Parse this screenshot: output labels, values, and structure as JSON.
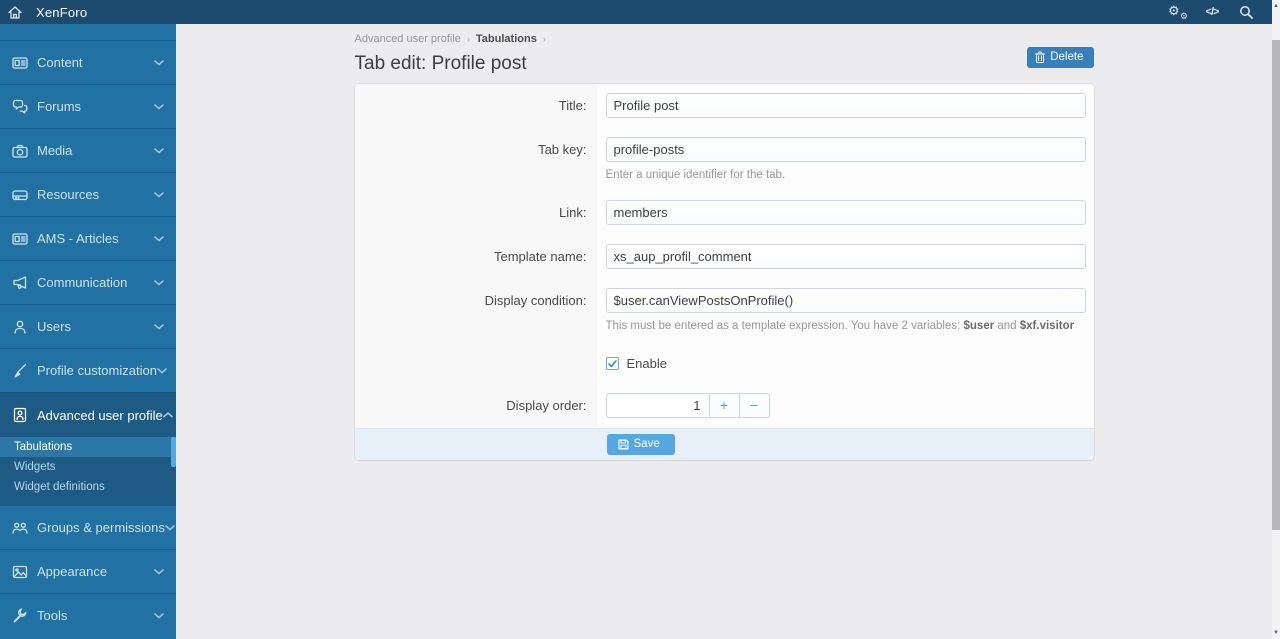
{
  "topbar": {
    "brand": "XenForo",
    "icons": [
      "home-icon",
      "gears-icon",
      "code-icon",
      "search-icon"
    ],
    "code_glyph": "</>"
  },
  "sidebar": {
    "items": [
      {
        "label": "Content",
        "icon": "content-icon"
      },
      {
        "label": "Forums",
        "icon": "forums-icon"
      },
      {
        "label": "Media",
        "icon": "media-icon"
      },
      {
        "label": "Resources",
        "icon": "resources-icon"
      },
      {
        "label": "AMS - Articles",
        "icon": "articles-icon"
      },
      {
        "label": "Communication",
        "icon": "communication-icon"
      },
      {
        "label": "Users",
        "icon": "users-icon"
      },
      {
        "label": "Profile customization",
        "icon": "profile-customization-icon"
      }
    ],
    "group": {
      "label": "Advanced user profile",
      "icon": "advanced-user-profile-icon",
      "expanded": true,
      "subitems": [
        {
          "label": "Tabulations",
          "selected": true
        },
        {
          "label": "Widgets",
          "selected": false
        },
        {
          "label": "Widget definitions",
          "selected": false
        }
      ]
    },
    "items_after": [
      {
        "label": "Groups & permissions",
        "icon": "groups-icon"
      },
      {
        "label": "Appearance",
        "icon": "appearance-icon"
      },
      {
        "label": "Tools",
        "icon": "tools-icon"
      }
    ]
  },
  "breadcrumb": {
    "separator": "›",
    "items": [
      "Advanced user profile",
      "Tabulations"
    ]
  },
  "page": {
    "title": "Tab edit: Profile post"
  },
  "actions": {
    "delete_label": "Delete",
    "save_label": "Save"
  },
  "form": {
    "title": {
      "label": "Title:",
      "value": "Profile post"
    },
    "tab_key": {
      "label": "Tab key:",
      "value": "profile-posts",
      "hint": "Enter a unique identifier for the tab."
    },
    "link": {
      "label": "Link:",
      "value": "members"
    },
    "template_name": {
      "label": "Template name:",
      "value": "xs_aup_profil_comment"
    },
    "display_condition": {
      "label": "Display condition:",
      "value": "$user.canViewPostsOnProfile()",
      "hint_prefix": "This must be entered as a template expression. You have 2 variables: ",
      "var1": "$user",
      "hint_and": " and ",
      "var2": "$xf.visitor"
    },
    "enable": {
      "label": "Enable",
      "checked": true
    },
    "display_order": {
      "label": "Display order:",
      "value": "1",
      "plus": "+",
      "minus": "−"
    }
  },
  "colors": {
    "topbar_bg": "#1d4b70",
    "sidebar_bg": "#2171a3",
    "sidebar_group_bg": "#1d5b85",
    "sidebar_selected_bg": "#2b77a7",
    "accent_save": "#56a6e4",
    "accent_delete": "#3580bd",
    "footer_bg": "#e7f0f9",
    "page_bg": "#ececee"
  }
}
